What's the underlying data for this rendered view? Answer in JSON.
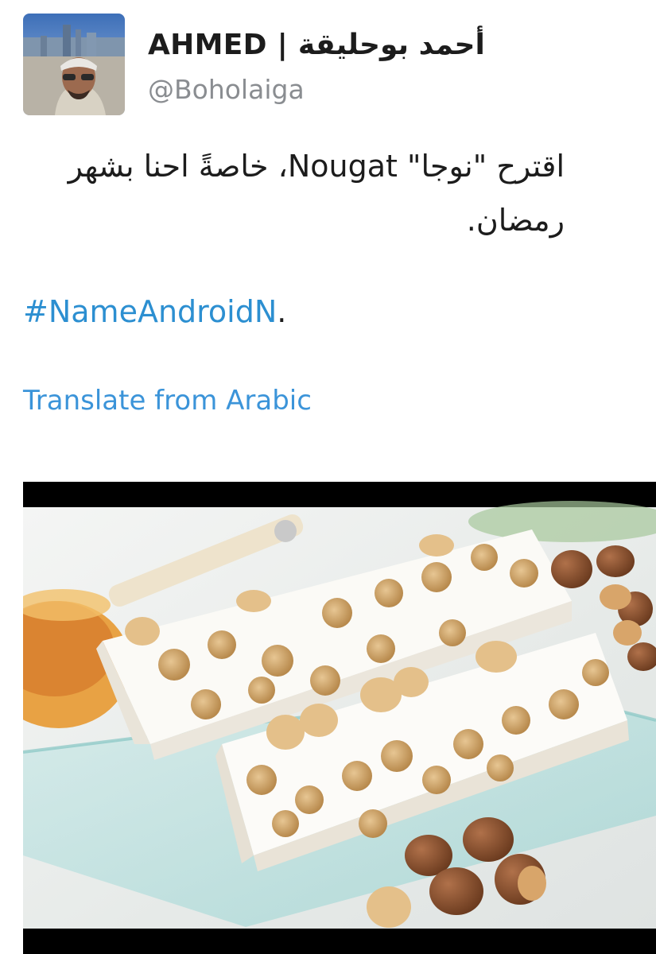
{
  "author": {
    "display_name": "AHMED | أحمد بوحليقة",
    "handle": "@Boholaiga",
    "avatar_icon": "profile-photo-icon"
  },
  "tweet": {
    "text_line1": "اقترح \"نوجا\" Nougat، خاصةً احنا بشهر",
    "text_line2": "رمضان.",
    "hashtag": "#NameAndroidN",
    "hashtag_suffix": "."
  },
  "translate": {
    "label": "Translate from Arabic"
  },
  "colors": {
    "link": "#2c8fd1",
    "text": "#1c1c1c",
    "muted": "#8a8d91"
  },
  "media": {
    "icon": "nougat-photo-icon"
  }
}
